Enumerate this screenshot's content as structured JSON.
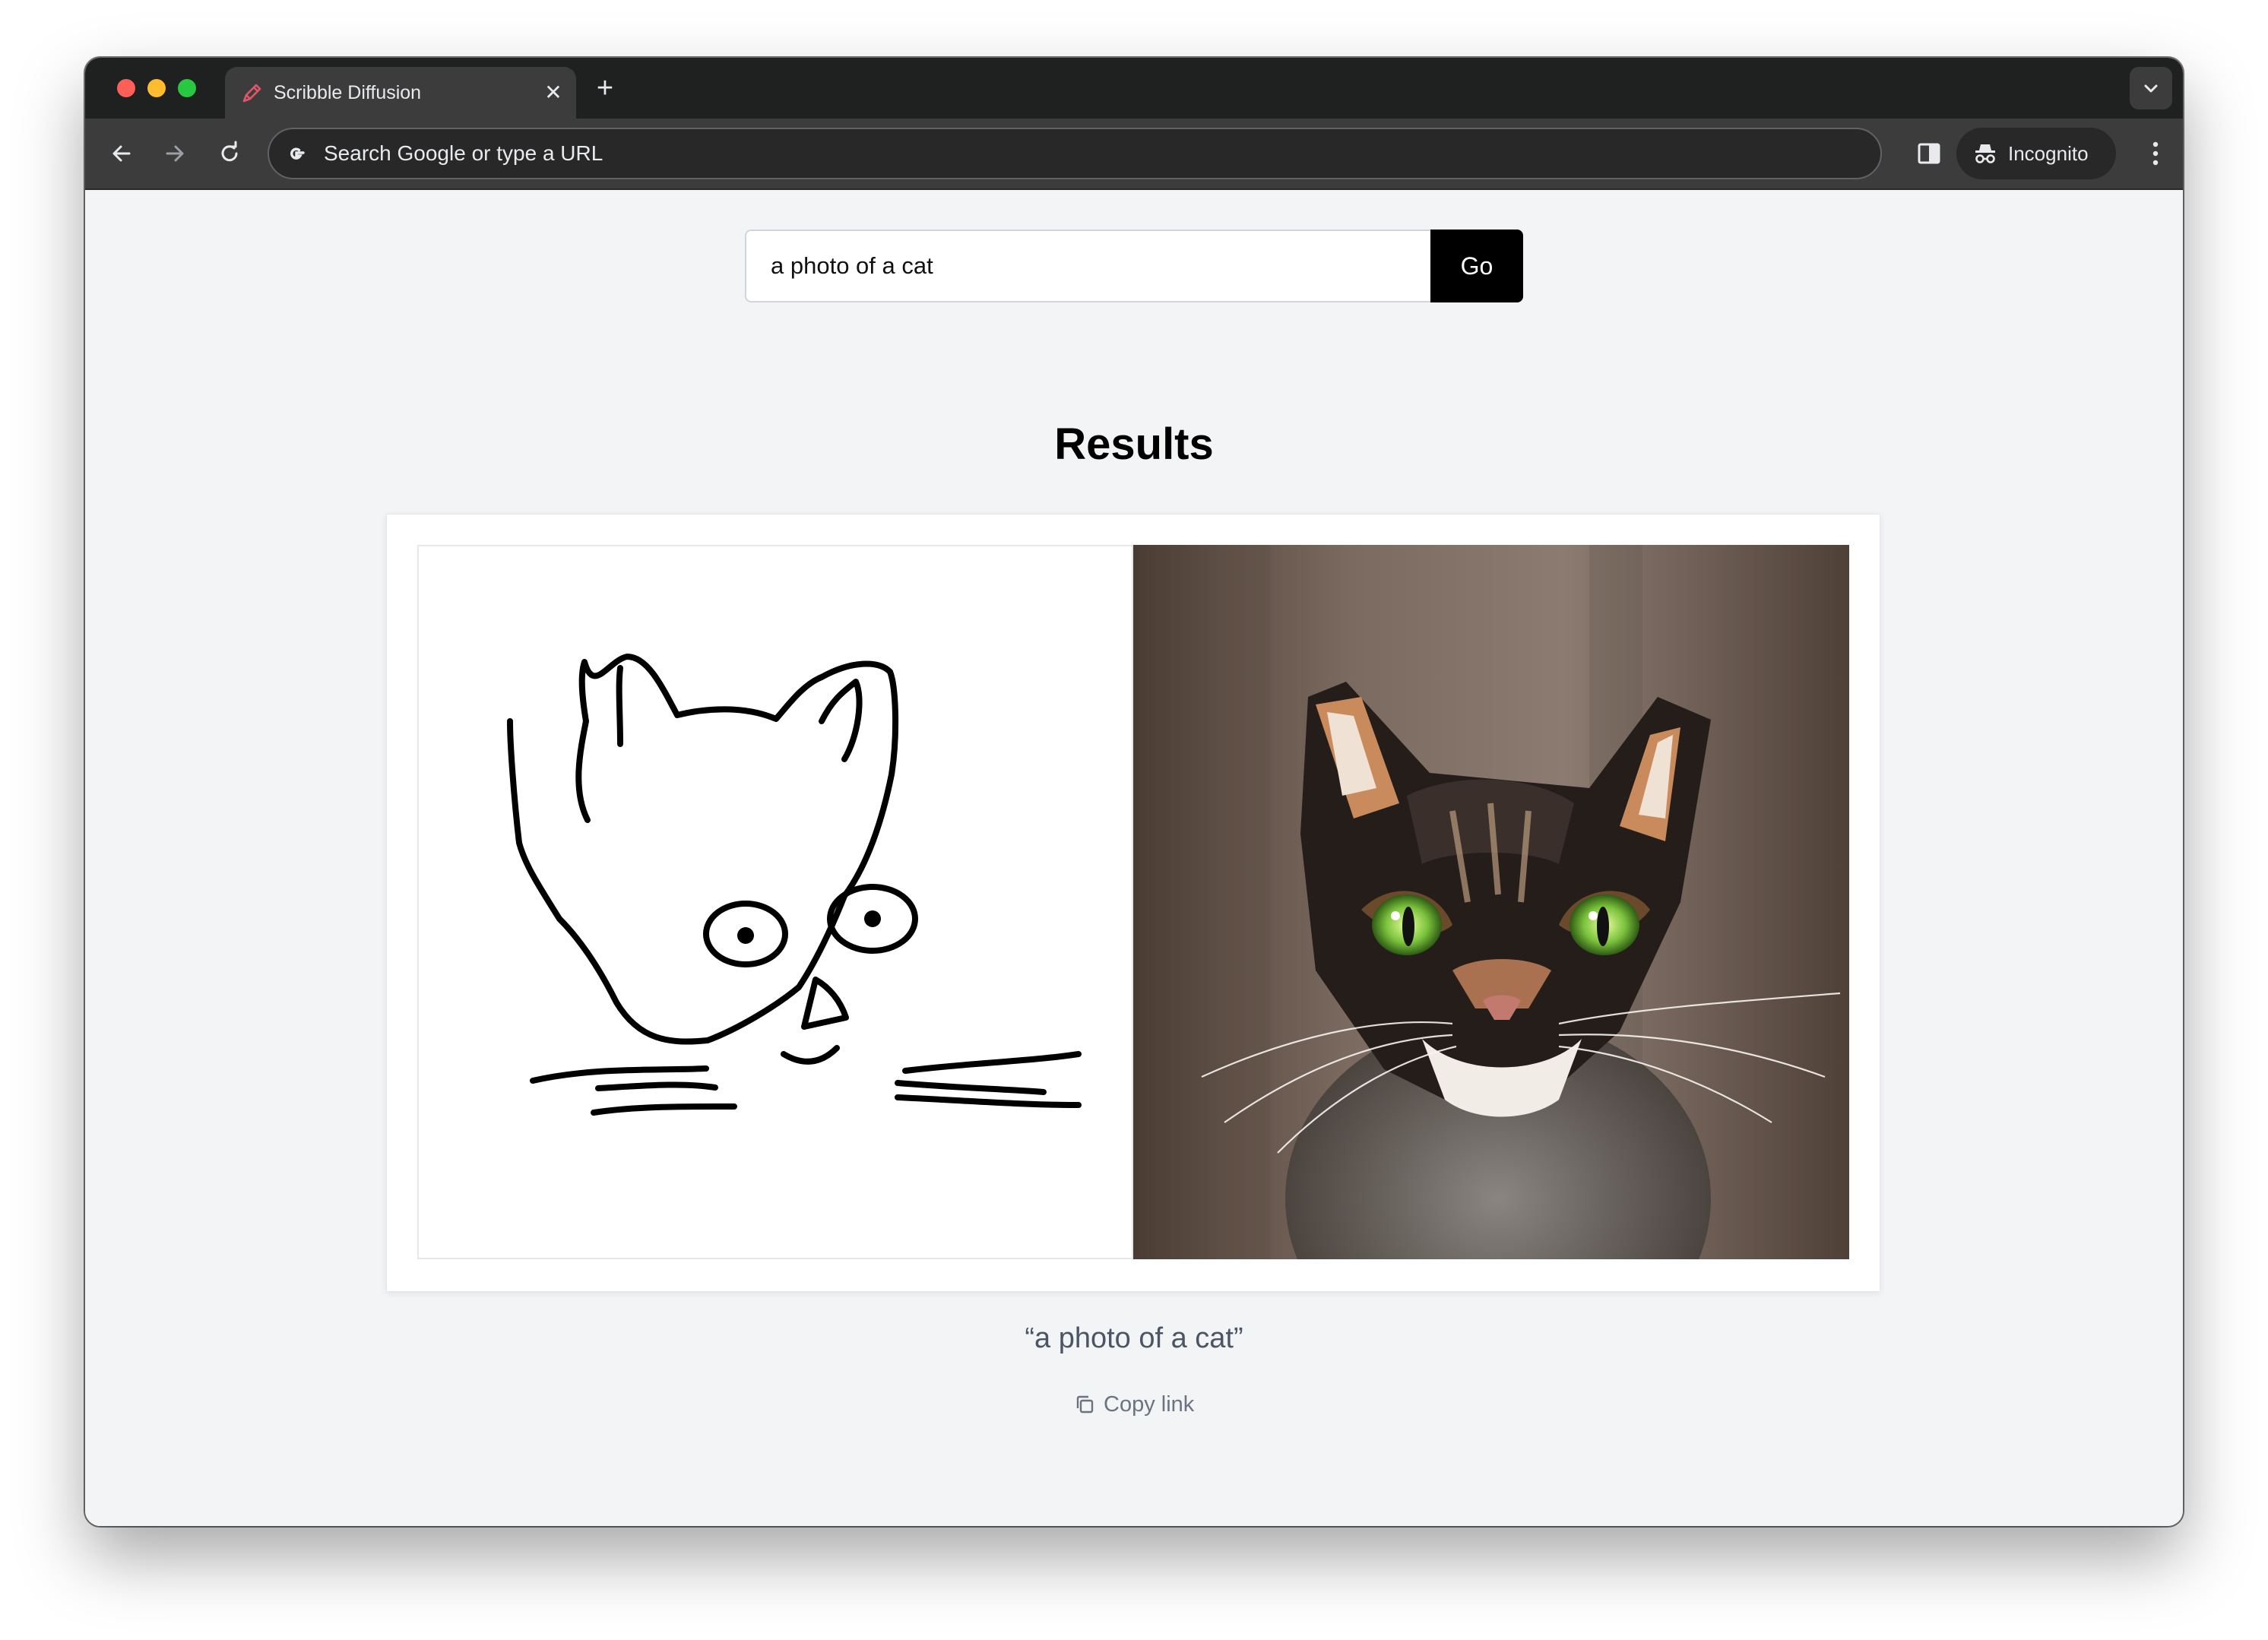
{
  "browser": {
    "tab": {
      "title": "Scribble Diffusion",
      "close_glyph": "✕"
    },
    "new_tab_glyph": "+",
    "omnibox": {
      "placeholder": "Search Google or type a URL"
    },
    "profile": {
      "label": "Incognito"
    },
    "colors": {
      "close": "#fe5f57",
      "minimize": "#febc2e",
      "maximize": "#28c840",
      "frame": "#1f2020",
      "toolbar": "#3c3c3c"
    }
  },
  "page": {
    "prompt": {
      "value": "a photo of a cat"
    },
    "go_label": "Go",
    "results_title": "Results",
    "caption": "“a photo of a cat”",
    "copy_link_label": "Copy link",
    "images": {
      "scribble_icon": "cat-scribble-drawing",
      "photo_icon": "generated-cat-photo"
    }
  }
}
